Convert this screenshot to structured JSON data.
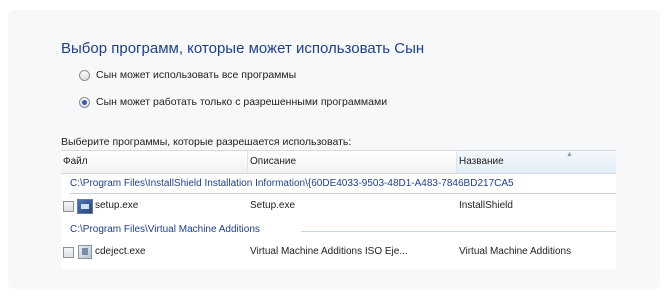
{
  "title": "Выбор программ, которые может использовать Сын",
  "options": [
    {
      "label": "Сын может использовать все программы",
      "selected": false
    },
    {
      "label": "Сын может работать только с разрешенными программами",
      "selected": true
    }
  ],
  "list_label": "Выберите программы, которые разрешается использовать:",
  "columns": [
    "Файл",
    "Описание",
    "Название"
  ],
  "groups": [
    {
      "path": "C:\\Program Files\\InstallShield Installation Information\\{60DE4033-9503-48D1-A483-7846BD217CA5",
      "rows": [
        {
          "file": "setup.exe",
          "description": "Setup.exe",
          "name": "InstallShield",
          "checked": false
        }
      ]
    },
    {
      "path": "C:\\Program Files\\Virtual Machine Additions",
      "rows": [
        {
          "file": "cdeject.exe",
          "description": "Virtual Machine Additions ISO Eje...",
          "name": "Virtual Machine Additions",
          "checked": false
        }
      ]
    }
  ],
  "icons": {
    "setup": "installer-icon",
    "cdeject": "application-icon",
    "radio": "radio-icon"
  }
}
